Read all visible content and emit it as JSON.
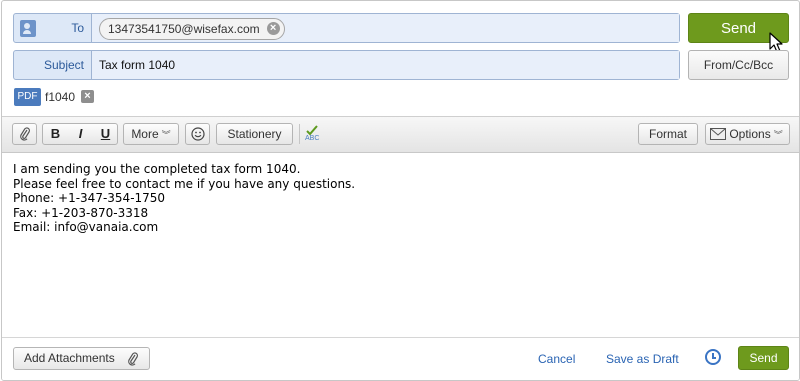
{
  "header": {
    "to_label": "To",
    "to_recipient": "13473541750@wisefax.com",
    "subject_label": "Subject",
    "subject_value": "Tax form 1040",
    "send_label": "Send",
    "from_cc_bcc_label": "From/Cc/Bcc",
    "attachment": {
      "type_badge": "PDF",
      "name": "f1040"
    }
  },
  "toolbar": {
    "bold": "B",
    "italic": "I",
    "underline": "U",
    "more_label": "More",
    "stationery_label": "Stationery",
    "spellcheck_badge": "ABC",
    "format_label": "Format",
    "options_label": "Options"
  },
  "body": {
    "lines": [
      "I am sending you the completed tax form 1040.",
      "Please feel free to contact me if you have any questions.",
      "Phone: +1-347-354-1750",
      "Fax: +1-203-870-3318",
      "Email: info@vanaia.com"
    ]
  },
  "footer": {
    "add_attachments_label": "Add Attachments",
    "cancel_label": "Cancel",
    "save_draft_label": "Save as Draft",
    "send_label": "Send"
  },
  "colors": {
    "send_green": "#6e9a1d",
    "link_blue": "#2a64b3",
    "field_blue": "#dde8f7"
  }
}
